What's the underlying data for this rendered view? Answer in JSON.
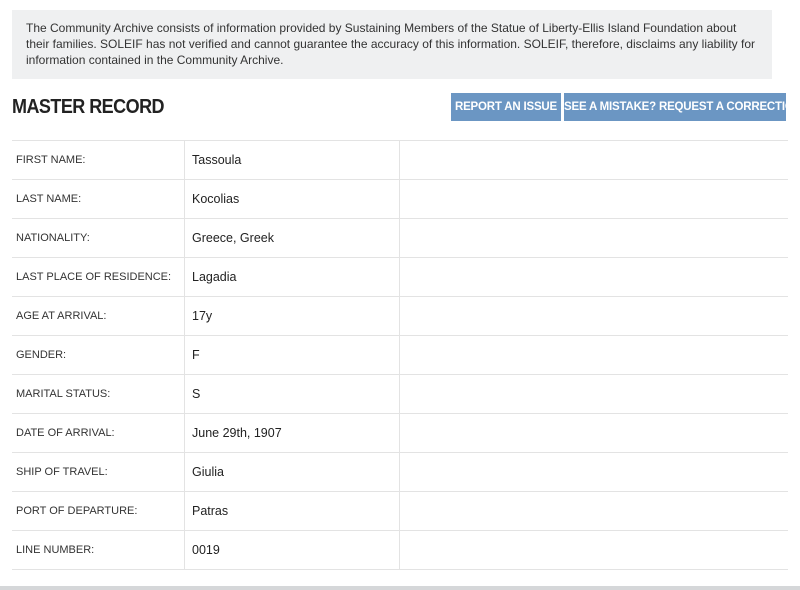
{
  "disclaimer": {
    "text": "The Community Archive consists of information provided by Sustaining Members of the Statue of Liberty-Ellis Island Foundation about their families. SOLEIF has not verified and cannot guarantee the accuracy of this information. SOLEIF, therefore, disclaims any liability for information contained in the Community Archive."
  },
  "header": {
    "title": "MASTER RECORD",
    "report_label": "REPORT AN ISSUE",
    "correction_label": "SEE A MISTAKE? REQUEST A CORRECTION"
  },
  "colors": {
    "button_bg": "#6b96c3",
    "disclaimer_bg": "#eff0f1"
  },
  "record": {
    "rows": [
      {
        "label": "FIRST NAME:",
        "value": "Tassoula"
      },
      {
        "label": "LAST NAME:",
        "value": "Kocolias"
      },
      {
        "label": "NATIONALITY:",
        "value": "Greece, Greek"
      },
      {
        "label": "LAST PLACE OF RESIDENCE:",
        "value": "Lagadia"
      },
      {
        "label": "AGE AT ARRIVAL:",
        "value": "17y"
      },
      {
        "label": "GENDER:",
        "value": "F"
      },
      {
        "label": "MARITAL STATUS:",
        "value": "S"
      },
      {
        "label": "DATE OF ARRIVAL:",
        "value": "June 29th, 1907"
      },
      {
        "label": "SHIP OF TRAVEL:",
        "value": "Giulia"
      },
      {
        "label": "PORT OF DEPARTURE:",
        "value": "Patras"
      },
      {
        "label": "LINE NUMBER:",
        "value": "0019"
      }
    ]
  }
}
